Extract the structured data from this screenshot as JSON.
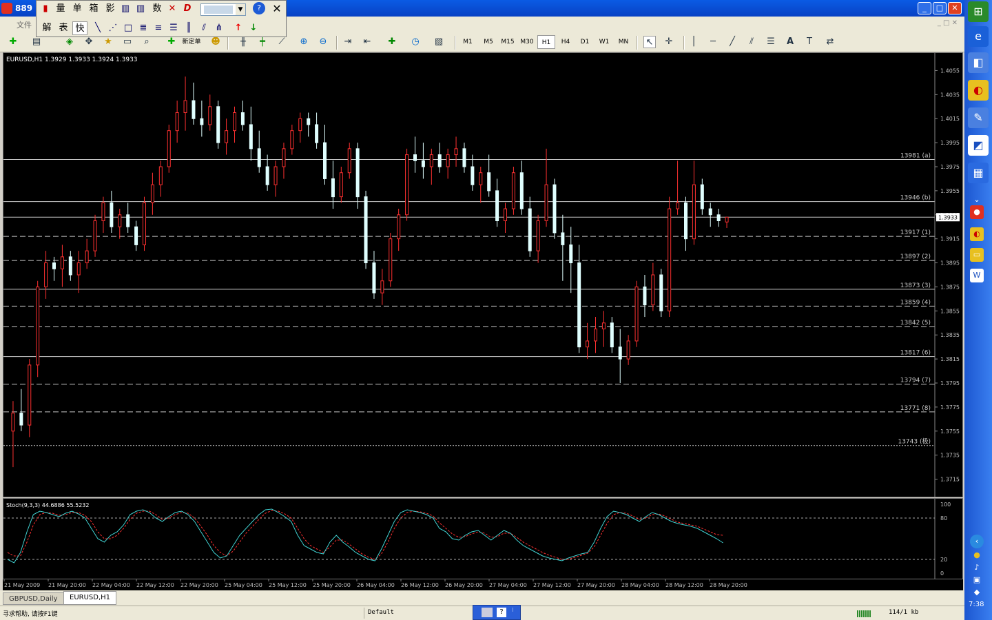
{
  "window": {
    "title": "889",
    "menu_file": "文件",
    "min": "_",
    "max": "□",
    "close": "✕"
  },
  "floatpanel": {
    "row1": [
      "量",
      "单",
      "箱",
      "影",
      "数"
    ],
    "row2": [
      "解",
      "表",
      "快"
    ],
    "combo_value": ""
  },
  "toolbar": {
    "new_order": "新定单",
    "timeframes": [
      "M1",
      "M5",
      "M15",
      "M30",
      "H1",
      "H4",
      "D1",
      "W1",
      "MN"
    ],
    "active_timeframe": "H1",
    "text_tool": "A"
  },
  "chart": {
    "header": "EURUSD,H1  1.3929 1.3933 1.3924 1.3933",
    "current_price": "1.3933",
    "price_ticks": [
      "1.4055",
      "1.4035",
      "1.4015",
      "1.3995",
      "1.3975",
      "1.3955",
      "1.3935",
      "1.3915",
      "1.3895",
      "1.3875",
      "1.3855",
      "1.3835",
      "1.3815",
      "1.3795",
      "1.3775",
      "1.3755",
      "1.3735",
      "1.3715"
    ],
    "levels": [
      {
        "label": "13981 (a)",
        "price": 1.3981,
        "style": "solid"
      },
      {
        "label": "13946 (b)",
        "price": 1.3946,
        "style": "solid"
      },
      {
        "label": "",
        "price": 1.3933,
        "style": "solid"
      },
      {
        "label": "13917 (1)",
        "price": 1.3917,
        "style": "dashed"
      },
      {
        "label": "13897 (2)",
        "price": 1.3897,
        "style": "dashed"
      },
      {
        "label": "13873 (3)",
        "price": 1.3873,
        "style": "solid"
      },
      {
        "label": "13859 (4)",
        "price": 1.3859,
        "style": "dashed"
      },
      {
        "label": "13842 (5)",
        "price": 1.3842,
        "style": "dashed"
      },
      {
        "label": "13817 (6)",
        "price": 1.3817,
        "style": "solid"
      },
      {
        "label": "13794 (7)",
        "price": 1.3794,
        "style": "dashed"
      },
      {
        "label": "13771 (8)",
        "price": 1.3771,
        "style": "dashed"
      },
      {
        "label": "13743 (极)",
        "price": 1.3743,
        "style": "dotted"
      }
    ],
    "colors": {
      "bull": "#ff3030",
      "bear": "#e0ffff",
      "bg": "#000000",
      "grid_text": "#c0c0c0"
    }
  },
  "chart_data": {
    "type": "candlestick",
    "title": "EURUSD,H1",
    "ylim": [
      1.3705,
      1.4065
    ],
    "candles": [
      [
        1.3755,
        1.378,
        1.3725,
        1.377
      ],
      [
        1.377,
        1.379,
        1.3755,
        1.376
      ],
      [
        1.376,
        1.3815,
        1.375,
        1.381
      ],
      [
        1.381,
        1.388,
        1.38,
        1.3875
      ],
      [
        1.3875,
        1.3905,
        1.3865,
        1.3895
      ],
      [
        1.3895,
        1.39,
        1.388,
        1.389
      ],
      [
        1.389,
        1.391,
        1.3875,
        1.39
      ],
      [
        1.39,
        1.3905,
        1.388,
        1.3885
      ],
      [
        1.3885,
        1.3905,
        1.387,
        1.3895
      ],
      [
        1.3895,
        1.3915,
        1.389,
        1.3905
      ],
      [
        1.3905,
        1.3935,
        1.39,
        1.393
      ],
      [
        1.393,
        1.395,
        1.392,
        1.3945
      ],
      [
        1.3945,
        1.3955,
        1.392,
        1.3925
      ],
      [
        1.3925,
        1.394,
        1.3915,
        1.3935
      ],
      [
        1.3935,
        1.3945,
        1.392,
        1.3925
      ],
      [
        1.3925,
        1.393,
        1.3905,
        1.391
      ],
      [
        1.391,
        1.395,
        1.3905,
        1.3945
      ],
      [
        1.3945,
        1.397,
        1.3935,
        1.396
      ],
      [
        1.396,
        1.398,
        1.395,
        1.3975
      ],
      [
        1.3975,
        1.401,
        1.397,
        1.4005
      ],
      [
        1.4005,
        1.403,
        1.3995,
        1.402
      ],
      [
        1.402,
        1.405,
        1.4005,
        1.403
      ],
      [
        1.403,
        1.4045,
        1.401,
        1.4015
      ],
      [
        1.4015,
        1.403,
        1.4,
        1.401
      ],
      [
        1.401,
        1.4035,
        1.4005,
        1.4025
      ],
      [
        1.4025,
        1.403,
        1.399,
        1.3995
      ],
      [
        1.3995,
        1.4015,
        1.3985,
        1.4005
      ],
      [
        1.4005,
        1.4025,
        1.3995,
        1.402
      ],
      [
        1.402,
        1.403,
        1.4005,
        1.401
      ],
      [
        1.401,
        1.4025,
        1.398,
        1.399
      ],
      [
        1.399,
        1.4005,
        1.397,
        1.3975
      ],
      [
        1.3975,
        1.3985,
        1.3955,
        1.396
      ],
      [
        1.396,
        1.398,
        1.395,
        1.3975
      ],
      [
        1.3975,
        1.3995,
        1.3965,
        1.399
      ],
      [
        1.399,
        1.401,
        1.3985,
        1.4005
      ],
      [
        1.4005,
        1.402,
        1.3995,
        1.4015
      ],
      [
        1.4015,
        1.402,
        1.4,
        1.401
      ],
      [
        1.401,
        1.402,
        1.399,
        1.3995
      ],
      [
        1.3995,
        1.401,
        1.396,
        1.3965
      ],
      [
        1.3965,
        1.398,
        1.394,
        1.395
      ],
      [
        1.395,
        1.3975,
        1.3945,
        1.397
      ],
      [
        1.397,
        1.3995,
        1.3965,
        1.399
      ],
      [
        1.399,
        1.3995,
        1.394,
        1.395
      ],
      [
        1.395,
        1.3955,
        1.389,
        1.3895
      ],
      [
        1.3895,
        1.3905,
        1.3865,
        1.387
      ],
      [
        1.387,
        1.389,
        1.386,
        1.388
      ],
      [
        1.388,
        1.392,
        1.3875,
        1.3915
      ],
      [
        1.3915,
        1.394,
        1.3905,
        1.3935
      ],
      [
        1.3935,
        1.399,
        1.393,
        1.3985
      ],
      [
        1.3985,
        1.4,
        1.397,
        1.398
      ],
      [
        1.398,
        1.3995,
        1.3965,
        1.3975
      ],
      [
        1.3975,
        1.399,
        1.396,
        1.3985
      ],
      [
        1.3985,
        1.3995,
        1.397,
        1.3975
      ],
      [
        1.3975,
        1.399,
        1.3965,
        1.3985
      ],
      [
        1.3985,
        1.4,
        1.3975,
        1.399
      ],
      [
        1.399,
        1.3995,
        1.397,
        1.3975
      ],
      [
        1.3975,
        1.3985,
        1.3955,
        1.396
      ],
      [
        1.396,
        1.3975,
        1.3945,
        1.397
      ],
      [
        1.397,
        1.3985,
        1.395,
        1.3955
      ],
      [
        1.3955,
        1.3965,
        1.3925,
        1.393
      ],
      [
        1.393,
        1.3945,
        1.392,
        1.394
      ],
      [
        1.394,
        1.3975,
        1.3935,
        1.397
      ],
      [
        1.397,
        1.398,
        1.3935,
        1.394
      ],
      [
        1.394,
        1.395,
        1.39,
        1.3905
      ],
      [
        1.3905,
        1.3935,
        1.3895,
        1.393
      ],
      [
        1.393,
        1.399,
        1.3925,
        1.396
      ],
      [
        1.396,
        1.3965,
        1.3915,
        1.392
      ],
      [
        1.392,
        1.3935,
        1.388,
        1.391
      ],
      [
        1.391,
        1.3925,
        1.387,
        1.3895
      ],
      [
        1.3895,
        1.391,
        1.382,
        1.3825
      ],
      [
        1.3825,
        1.3845,
        1.3815,
        1.383
      ],
      [
        1.383,
        1.385,
        1.382,
        1.384
      ],
      [
        1.384,
        1.3855,
        1.3825,
        1.3845
      ],
      [
        1.3845,
        1.385,
        1.382,
        1.3825
      ],
      [
        1.3825,
        1.384,
        1.3795,
        1.3815
      ],
      [
        1.3815,
        1.3835,
        1.381,
        1.383
      ],
      [
        1.383,
        1.388,
        1.3825,
        1.3875
      ],
      [
        1.3875,
        1.3885,
        1.385,
        1.386
      ],
      [
        1.386,
        1.3895,
        1.3855,
        1.3885
      ],
      [
        1.3885,
        1.389,
        1.385,
        1.3855
      ],
      [
        1.3855,
        1.395,
        1.385,
        1.394
      ],
      [
        1.394,
        1.398,
        1.3935,
        1.3945
      ],
      [
        1.3945,
        1.395,
        1.3905,
        1.3915
      ],
      [
        1.3915,
        1.398,
        1.391,
        1.396
      ],
      [
        1.396,
        1.3965,
        1.3935,
        1.394
      ],
      [
        1.394,
        1.3945,
        1.3925,
        1.3935
      ],
      [
        1.3935,
        1.394,
        1.3925,
        1.393
      ],
      [
        1.3929,
        1.3933,
        1.3924,
        1.3933
      ]
    ],
    "indicator": {
      "name": "Stoch(9,3,3)",
      "main_value": "44.6886",
      "signal_value": "55.5232",
      "levels": [
        80,
        20
      ],
      "axis_ticks": [
        "100",
        "80",
        "20",
        "0"
      ],
      "main": [
        20,
        15,
        30,
        60,
        85,
        90,
        88,
        85,
        82,
        87,
        90,
        86,
        80,
        65,
        50,
        45,
        55,
        60,
        70,
        85,
        90,
        92,
        88,
        80,
        75,
        82,
        88,
        90,
        85,
        75,
        60,
        45,
        30,
        22,
        25,
        40,
        55,
        65,
        75,
        85,
        92,
        93,
        88,
        82,
        75,
        55,
        40,
        35,
        30,
        28,
        45,
        55,
        45,
        38,
        30,
        25,
        20,
        18,
        35,
        55,
        75,
        88,
        92,
        90,
        88,
        85,
        80,
        65,
        60,
        50,
        48,
        55,
        60,
        62,
        55,
        48,
        55,
        62,
        58,
        48,
        40,
        35,
        30,
        25,
        22,
        20,
        18,
        22,
        25,
        28,
        30,
        45,
        65,
        82,
        90,
        88,
        85,
        80,
        75,
        82,
        88,
        85,
        80,
        75,
        72,
        70,
        68,
        65,
        60,
        55,
        50,
        44
      ],
      "signal": [
        30,
        25,
        25,
        45,
        70,
        85,
        88,
        87,
        84,
        85,
        88,
        88,
        84,
        75,
        60,
        50,
        50,
        55,
        65,
        78,
        87,
        90,
        90,
        85,
        78,
        80,
        85,
        88,
        87,
        80,
        68,
        55,
        40,
        30,
        25,
        32,
        45,
        58,
        68,
        78,
        87,
        91,
        90,
        86,
        80,
        65,
        50,
        40,
        35,
        30,
        38,
        48,
        48,
        42,
        35,
        28,
        23,
        20,
        28,
        45,
        65,
        80,
        88,
        90,
        89,
        87,
        83,
        73,
        65,
        57,
        52,
        53,
        57,
        60,
        58,
        52,
        53,
        58,
        58,
        52,
        45,
        40,
        35,
        30,
        26,
        23,
        20,
        20,
        23,
        26,
        29,
        38,
        55,
        72,
        85,
        88,
        87,
        83,
        78,
        80,
        85,
        86,
        83,
        78,
        74,
        72,
        70,
        68,
        64,
        60,
        56,
        55
      ]
    },
    "time_labels": [
      "21 May 2009",
      "21 May 20:00",
      "22 May 04:00",
      "22 May 12:00",
      "22 May 20:00",
      "25 May 04:00",
      "25 May 12:00",
      "25 May 20:00",
      "26 May 04:00",
      "26 May 12:00",
      "26 May 20:00",
      "27 May 04:00",
      "27 May 12:00",
      "27 May 20:00",
      "28 May 04:00",
      "28 May 12:00",
      "28 May 20:00"
    ]
  },
  "tabs": [
    {
      "label": "GBPUSD,Daily",
      "active": false
    },
    {
      "label": "EURUSD,H1",
      "active": true
    }
  ],
  "status": {
    "help": "寻求帮助, 请按F1键",
    "profile": "Default",
    "traffic": "114/1 kb"
  },
  "taskbar": {
    "clock": "7:38"
  }
}
